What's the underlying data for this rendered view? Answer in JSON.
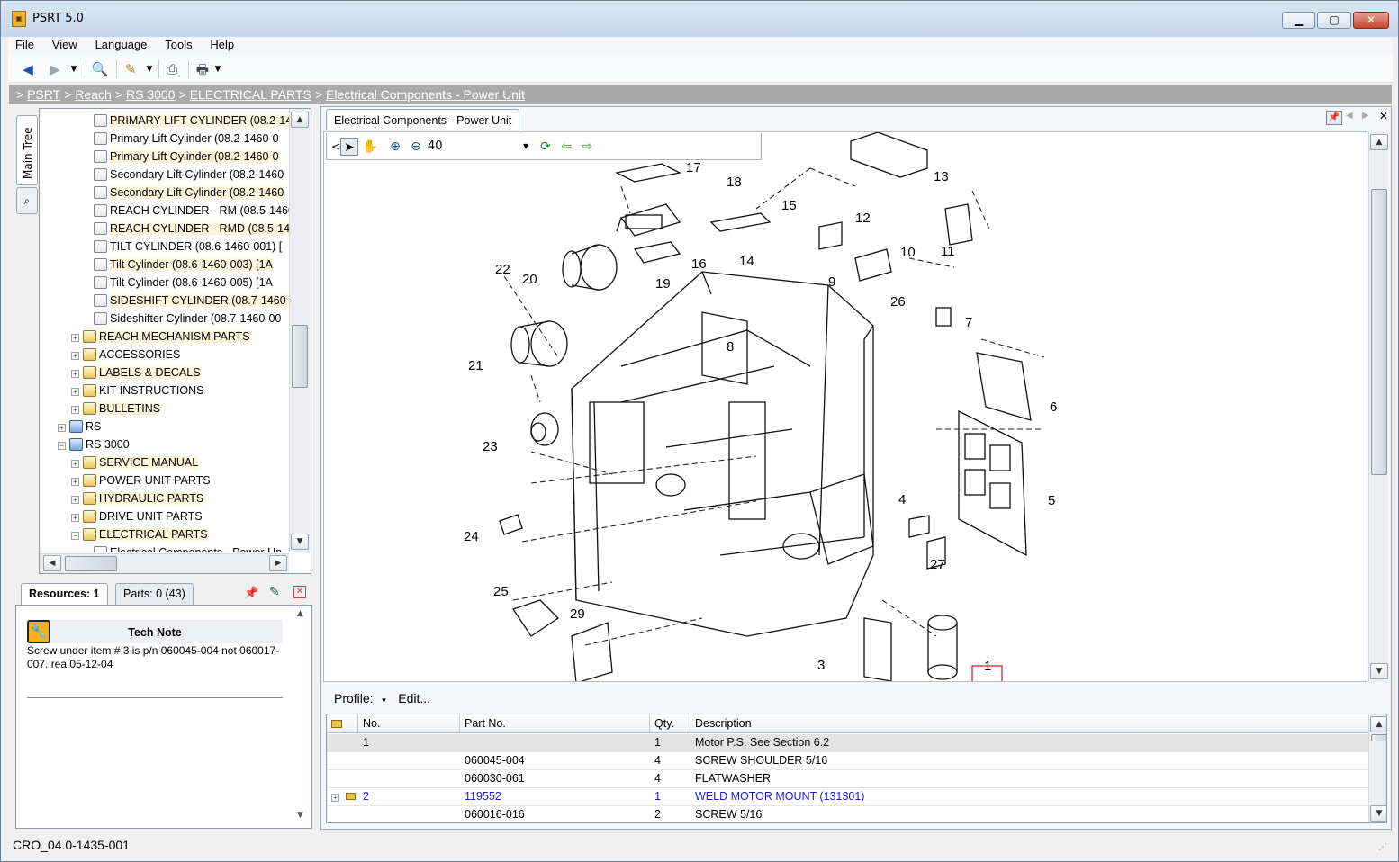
{
  "window": {
    "title": "PSRT 5.0",
    "icon": "app-logo-icon",
    "minimize": "▁",
    "maximize": "▢",
    "close": "✕"
  },
  "menu": [
    "File",
    "View",
    "Language",
    "Tools",
    "Help"
  ],
  "toolbar": {
    "icons": [
      "back-arrow-icon",
      "forward-arrow-icon",
      "dropdown-icon",
      "search-document-icon",
      "edit-notes-icon",
      "print-preview-icon",
      "print-icon"
    ]
  },
  "breadcrumb": {
    "prefix": ">",
    "items": [
      "PSRT",
      "Reach",
      "RS 3000",
      "ELECTRICAL PARTS",
      "Electrical Components - Power Unit"
    ]
  },
  "side_tabs": {
    "main_tree": "Main Tree",
    "search_icon": "search-icon"
  },
  "tree": [
    {
      "label": "PRIMARY LIFT CYLINDER (08.2-14",
      "kind": "doc"
    },
    {
      "label": "Primary Lift Cylinder (08.2-1460-0",
      "kind": "doc"
    },
    {
      "label": "Primary Lift Cylinder (08.2-1460-0",
      "kind": "doc"
    },
    {
      "label": "Secondary Lift Cylinder (08.2-1460",
      "kind": "doc"
    },
    {
      "label": "Secondary Lift Cylinder (08.2-1460",
      "kind": "doc"
    },
    {
      "label": "REACH CYLINDER - RM (08.5-1460",
      "kind": "doc"
    },
    {
      "label": "REACH CYLINDER - RMD (08.5-146",
      "kind": "doc"
    },
    {
      "label": "TILT CYLINDER (08.6-1460-001)  [",
      "kind": "doc"
    },
    {
      "label": "Tilt Cylinder (08.6-1460-003)  [1A",
      "kind": "doc"
    },
    {
      "label": "Tilt Cylinder (08.6-1460-005)  [1A",
      "kind": "doc"
    },
    {
      "label": "SIDESHIFT CYLINDER (08.7-1460-",
      "kind": "doc"
    },
    {
      "label": "Sideshifter Cylinder (08.7-1460-00",
      "kind": "doc"
    },
    {
      "label": "REACH MECHANISM PARTS",
      "kind": "folder",
      "pm": "+"
    },
    {
      "label": "ACCESSORIES",
      "kind": "folder",
      "pm": "+"
    },
    {
      "label": "LABELS & DECALS",
      "kind": "folder",
      "pm": "+"
    },
    {
      "label": "KIT INSTRUCTIONS",
      "kind": "folder",
      "pm": "+"
    },
    {
      "label": "BULLETINS",
      "kind": "folder",
      "pm": "+"
    },
    {
      "label": "RS",
      "kind": "book",
      "pm": "+"
    },
    {
      "label": "RS 3000",
      "kind": "book",
      "pm": "−"
    },
    {
      "label": "SERVICE MANUAL",
      "kind": "folder",
      "pm": "+"
    },
    {
      "label": "POWER UNIT PARTS",
      "kind": "folder",
      "pm": "+"
    },
    {
      "label": "HYDRAULIC PARTS",
      "kind": "folder",
      "pm": "+"
    },
    {
      "label": "DRIVE UNIT PARTS",
      "kind": "folder",
      "pm": "+"
    },
    {
      "label": "ELECTRICAL PARTS",
      "kind": "folder",
      "pm": "−"
    },
    {
      "label": "Electrical Components - Power Un",
      "kind": "doc"
    }
  ],
  "resources": {
    "tab_resources": "Resources: 1",
    "tab_parts": "Parts: 0 (43)",
    "note_title": "Tech Note",
    "note_text": "Screw under item # 3 is p/n 060045-004 not 060017-007. rea 05-12-04"
  },
  "document": {
    "tab_label": "Electrical Components - Power Unit",
    "zoom": "40",
    "callouts": [
      "1",
      "3",
      "4",
      "5",
      "6",
      "7",
      "8",
      "9",
      "10",
      "11",
      "12",
      "13",
      "14",
      "15",
      "16",
      "17",
      "18",
      "19",
      "20",
      "21",
      "22",
      "23",
      "24",
      "25",
      "26",
      "27",
      "29"
    ]
  },
  "profile": {
    "label": "Profile:",
    "edit": "Edit..."
  },
  "parts_table": {
    "columns": [
      "No.",
      "Part No.",
      "Qty.",
      "Description"
    ],
    "rows": [
      {
        "no": "1",
        "part": "",
        "qty": "1",
        "desc": "Motor P.S. See Section 6.2",
        "selected": true
      },
      {
        "no": "",
        "part": "060045-004",
        "qty": "4",
        "desc": "SCREW SHOULDER 5/16"
      },
      {
        "no": "",
        "part": "060030-061",
        "qty": "4",
        "desc": "FLATWASHER"
      },
      {
        "no": "2",
        "part": "119552",
        "qty": "1",
        "desc": "WELD MOTOR MOUNT (131301)",
        "link": true,
        "expandable": true
      },
      {
        "no": "",
        "part": "060016-016",
        "qty": "2",
        "desc": "SCREW 5/16"
      }
    ]
  },
  "status_bar": "CRO_04.0-1435-001"
}
